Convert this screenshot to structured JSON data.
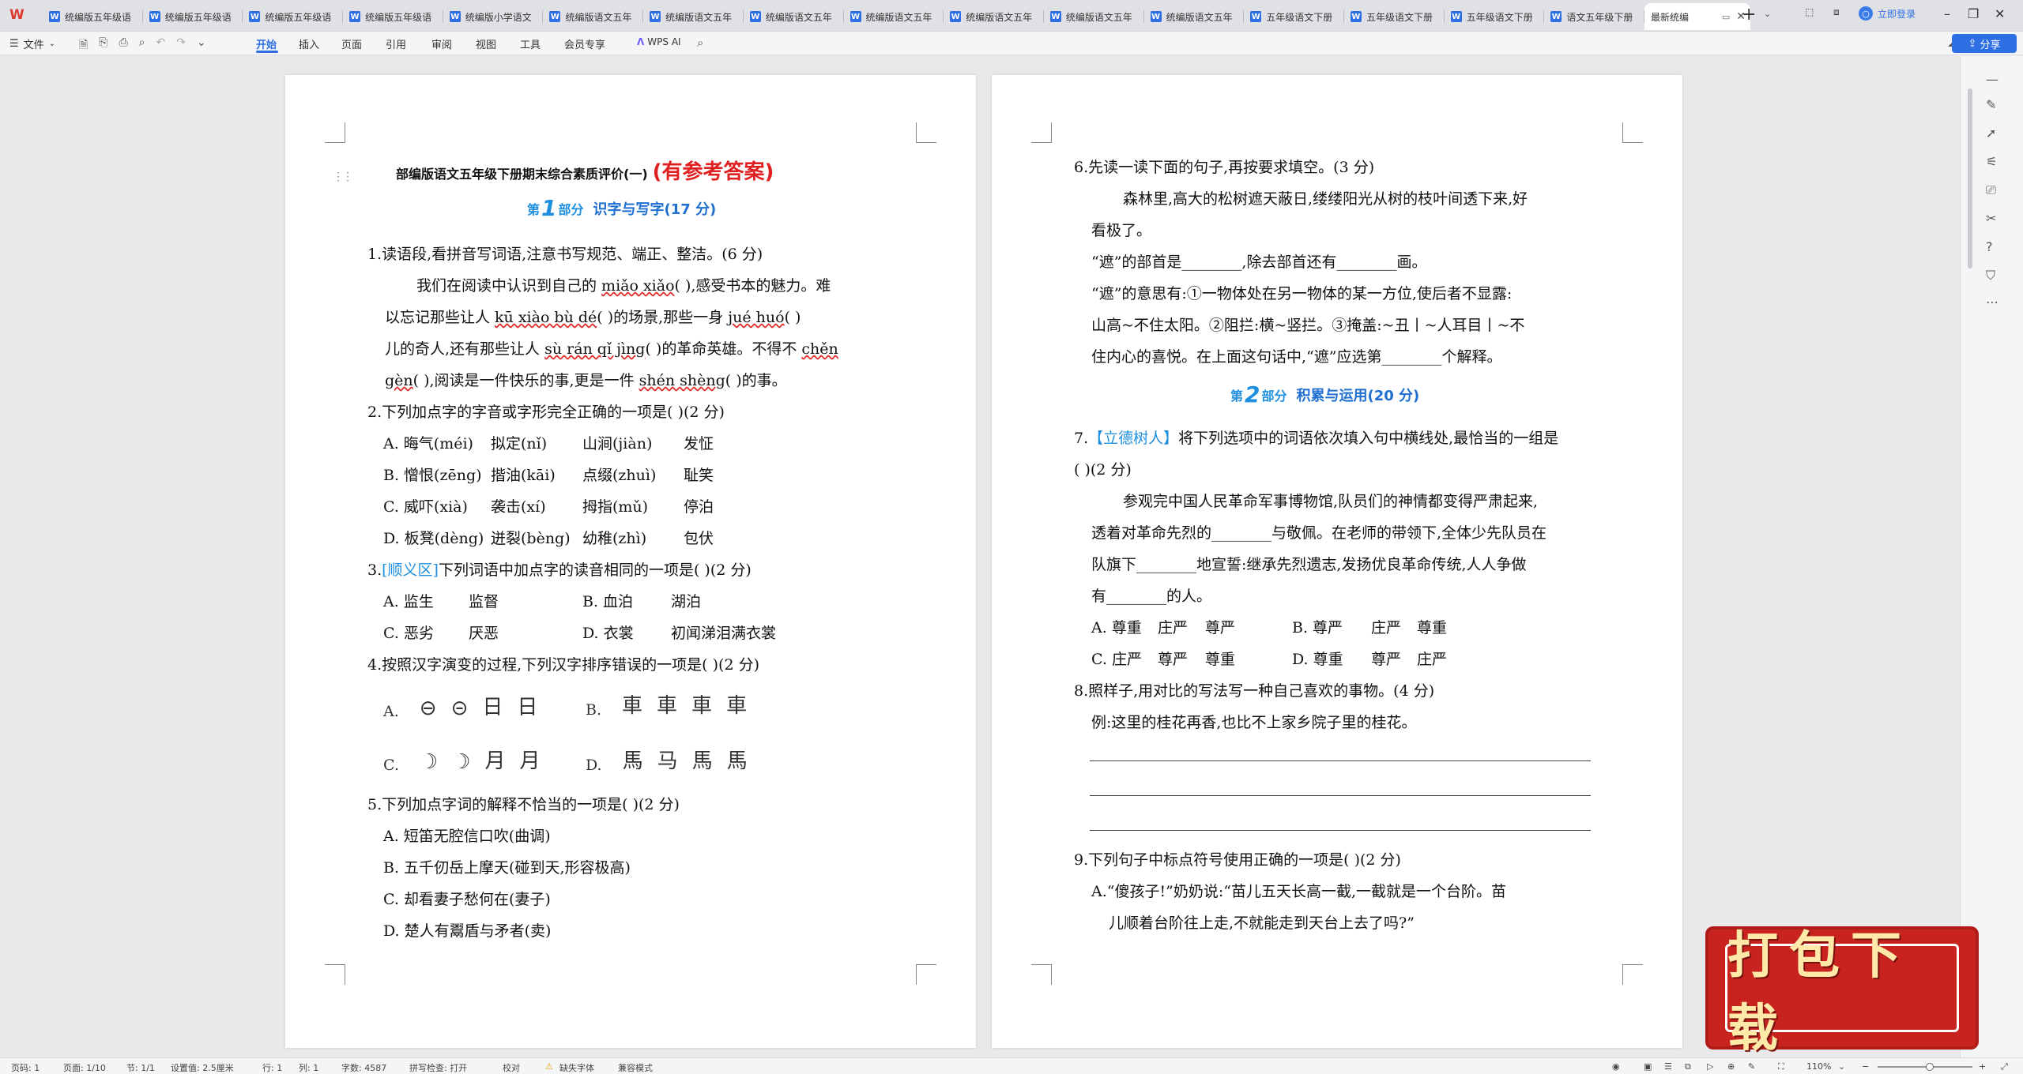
{
  "tabbar": {
    "app_logo": "W",
    "tabs": [
      {
        "label": "统编版五年级语"
      },
      {
        "label": "统编版五年级语"
      },
      {
        "label": "统编版五年级语"
      },
      {
        "label": "统编版五年级语"
      },
      {
        "label": "统编版小学语文"
      },
      {
        "label": "统编版语文五年"
      },
      {
        "label": "统编版语文五年"
      },
      {
        "label": "统编版语文五年"
      },
      {
        "label": "统编版语文五年"
      },
      {
        "label": "统编版语文五年"
      },
      {
        "label": "统编版语文五年"
      },
      {
        "label": "统编版语文五年"
      },
      {
        "label": "五年级语文下册"
      },
      {
        "label": "五年级语文下册"
      },
      {
        "label": "五年级语文下册"
      },
      {
        "label": "语文五年级下册"
      }
    ],
    "active_tab": {
      "label": "最新统编"
    },
    "login_label": "立即登录"
  },
  "ribbon": {
    "file_label": "文件",
    "tabs": [
      "开始",
      "插入",
      "页面",
      "引用",
      "审阅",
      "视图",
      "工具",
      "会员专享"
    ],
    "wps_ai_label": "WPS AI",
    "share_label": "分享"
  },
  "page1": {
    "title": "部编版语文五年级下册期末综合素质评价(一)",
    "title_red": "(有参考答案)",
    "part1": {
      "prefix": "第",
      "num": "1",
      "suffix": "部分",
      "name": "识字与写字(17 分)"
    },
    "q1": {
      "stem": "1.读语段,看拼音写词语,注意书写规范、端正、整洁。(6 分)",
      "l1a": "我们在阅读中认识到自己的 ",
      "l1p": "miǎo xiǎo",
      "l1b": "(        ),感受书本的魅力。难",
      "l2a": "以忘记那些让人 ",
      "l2p": "kū xiào bù dé",
      "l2b": "(              )的场景,那些一身 ",
      "l2p2": "jué huó",
      "l2c": "(        )",
      "l3a": "儿的奇人,还有那些让人 ",
      "l3p": "sù rán qǐ jìng",
      "l3b": "(              )的革命英雄。不得不 ",
      "l3p2": "chěn",
      "l4p": "gèn",
      "l4a": "(        ),阅读是一件快乐的事,更是一件 ",
      "l4p2": "shén shèng",
      "l4b": "(        )的事。"
    },
    "q2": {
      "stem": "2.下列加点字的字音或字形完全正确的一项是(        )(2 分)",
      "options": [
        [
          "A. 晦气(méi)",
          "拟定(nǐ)",
          "山涧(jiàn)",
          "发怔"
        ],
        [
          "B. 憎恨(zēng)",
          "揩油(kāi)",
          "点缀(zhuì)",
          "耻笑"
        ],
        [
          "C. 威吓(xià)",
          "袭击(xí)",
          "拇指(mǔ)",
          "停泊"
        ],
        [
          "D. 板凳(dèng)",
          "迸裂(bèng)",
          "幼稚(zhì)",
          "包伏"
        ]
      ]
    },
    "q3": {
      "num": "3.",
      "tag": "[顺义区]",
      "stem": "下列词语中加点字的读音相同的一项是(        )(2 分)",
      "options": [
        [
          "A. 监生",
          "监督",
          "B. 血泊",
          "湖泊"
        ],
        [
          "C. 恶劣",
          "厌恶",
          "D. 衣裳",
          "初闻涕泪满衣裳"
        ]
      ]
    },
    "q4": {
      "stem": "4.按照汉字演变的过程,下列汉字排序错误的一项是(        )(2 分)",
      "A": [
        "⊖",
        "⊝",
        "日",
        "日"
      ],
      "B": [
        "車",
        "車",
        "車",
        "車"
      ],
      "C": [
        "☽",
        "☽",
        "月",
        "月"
      ],
      "D": [
        "馬",
        "马",
        "馬",
        "馬"
      ],
      "labels": [
        "A.",
        "B.",
        "C.",
        "D."
      ]
    },
    "q5": {
      "stem": "5.下列加点字词的解释不恰当的一项是(        )(2 分)",
      "options": [
        "A. 短笛无腔信口吹(曲调)",
        "B. 五千仞岳上摩天(碰到天,形容极高)",
        "C. 却看妻子愁何在(妻子)",
        "D. 楚人有鬻盾与矛者(卖)"
      ]
    }
  },
  "page2": {
    "q6": {
      "stem": "6.先读一读下面的句子,再按要求填空。(3 分)",
      "l1": "森林里,高大的松树遮天蔽日,缕缕阳光从树的枝叶间透下来,好",
      "l2": "看极了。",
      "l3": "“遮”的部首是________,除去部首还有________画。",
      "l4": "“遮”的意思有:①一物体处在另一物体的某一方位,使后者不显露:",
      "l5": "山高~不住太阳。②阻拦:横~竖拦。③掩盖:~丑丨~人耳目丨~不",
      "l6": "住内心的喜悦。在上面这句话中,“遮”应选第________个解释。"
    },
    "part2": {
      "prefix": "第",
      "num": "2",
      "suffix": "部分",
      "name": "积累与运用(20 分)"
    },
    "q7": {
      "num": "7.",
      "tag": "【立德树人】",
      "stem": "将下列选项中的词语依次填入句中横线处,最恰当的一组是",
      "stem2": "(        )(2 分)",
      "p1": "参观完中国人民革命军事博物馆,队员们的神情都变得严肃起来,",
      "p2": "透着对革命先烈的________与敬佩。在老师的带领下,全体少先队员在",
      "p3": "队旗下________地宣誓:继承先烈遗志,发扬优良革命传统,人人争做",
      "p4": "有________的人。",
      "options": [
        [
          "A. 尊重",
          "庄严",
          "尊严",
          "B. 尊严",
          "庄严",
          "尊重"
        ],
        [
          "C. 庄严",
          "尊严",
          "尊重",
          "D. 尊重",
          "尊严",
          "庄严"
        ]
      ]
    },
    "q8": {
      "stem": "8.照样子,用对比的写法写一种自己喜欢的事物。(4 分)",
      "example": "例:这里的桂花再香,也比不上家乡院子里的桂花。"
    },
    "q9": {
      "stem": "9.下列句子中标点符号使用正确的一项是(        )(2 分)",
      "a1": "A.“傻孩子!”奶奶说:“苗儿五天长高一截,一截就是一个台阶。苗",
      "a2": "儿顺着台阶往上走,不就能走到天台上去了吗?”"
    }
  },
  "banner": {
    "text": "打包下载"
  },
  "statusbar": {
    "page_num": "页码: 1",
    "page_of": "页面: 1/10",
    "section": "节: 1/1",
    "setting": "设置值: 2.5厘米",
    "row": "行: 1",
    "col": "列: 1",
    "words": "字数: 4587",
    "spell": "拼写检查: 打开",
    "proof": "校对",
    "missing_font": "缺失字体",
    "compat": "兼容模式",
    "zoom": "110%",
    "zoom_fraction": 0.55
  }
}
